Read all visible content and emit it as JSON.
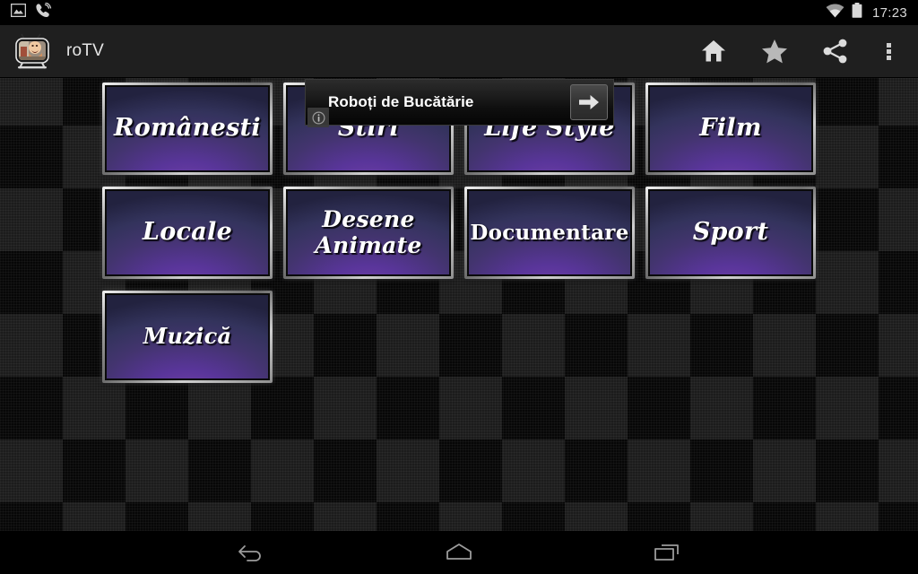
{
  "status_bar": {
    "left_icons": [
      {
        "name": "image-icon",
        "label": "Screenshot captured"
      },
      {
        "name": "phone-call-icon",
        "label": "Call in progress"
      }
    ],
    "right_icons": [
      {
        "name": "wifi-icon",
        "label": "Wi-Fi connected"
      },
      {
        "name": "battery-icon",
        "label": "Battery"
      }
    ],
    "clock": "17:23"
  },
  "action_bar": {
    "app_icon": "retro-tv-icon",
    "title": "roTV",
    "actions": [
      {
        "name": "home-icon",
        "label": "Home"
      },
      {
        "name": "star-icon",
        "label": "Favorites"
      },
      {
        "name": "share-icon",
        "label": "Share"
      },
      {
        "name": "overflow-menu-icon",
        "label": "More options"
      }
    ]
  },
  "ad_banner": {
    "text": "Roboți de Bucătărie",
    "arrow_icon": "arrow-right-icon",
    "info_icon": "info-icon",
    "info_label": "i"
  },
  "tiles": {
    "rows": [
      [
        {
          "label": "Românesti",
          "style": "italic"
        },
        {
          "label": "Stiri",
          "style": "italic"
        },
        {
          "label": "Life Style",
          "style": "italic"
        },
        {
          "label": "Film",
          "style": "italic"
        }
      ],
      [
        {
          "label": "Locale",
          "style": "italic"
        },
        {
          "label": "Desene\nAnimate",
          "style": "italic-two-line"
        },
        {
          "label": "Documentare",
          "style": "upright"
        },
        {
          "label": "Sport",
          "style": "italic"
        }
      ],
      [
        {
          "label": "Muzică",
          "style": "italic"
        }
      ]
    ]
  },
  "nav_bar": {
    "buttons": [
      {
        "name": "back-button",
        "label": "Back"
      },
      {
        "name": "home-button",
        "label": "Home"
      },
      {
        "name": "recents-button",
        "label": "Recent apps"
      }
    ]
  },
  "colors": {
    "status_bar_bg": "#000000",
    "action_bar_bg": "#1f1f1f",
    "tile_purple": "#5a3d8a",
    "tile_blue": "#33335c",
    "tile_border": "#c8c8c8",
    "text_primary": "#ffffff",
    "icon_gray": "#cfcfcf"
  }
}
